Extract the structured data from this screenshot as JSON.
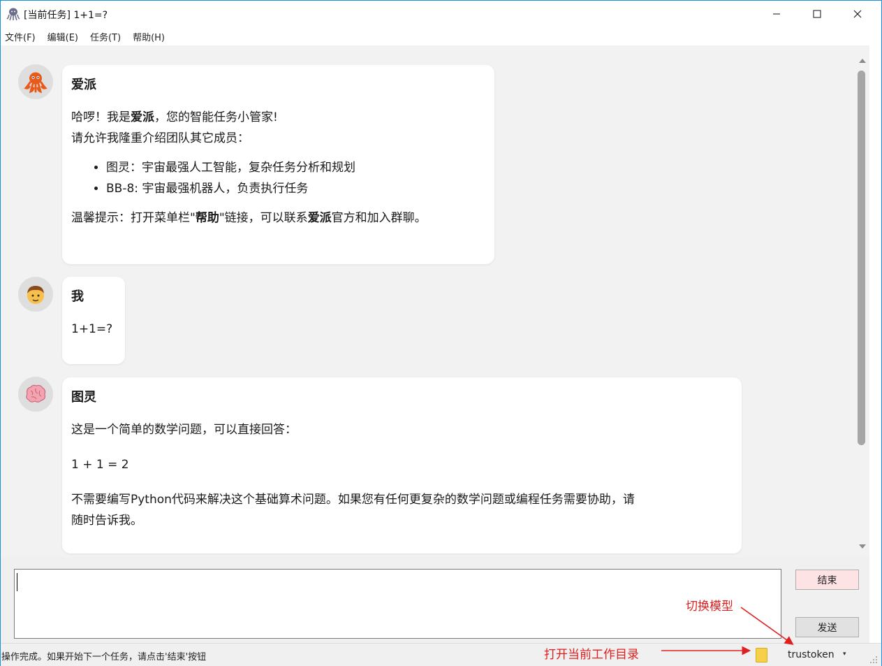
{
  "window": {
    "title": "[当前任务] 1+1=?",
    "controls": {
      "minimize": "—",
      "maximize": "☐",
      "close": "✕"
    }
  },
  "menu": [
    "文件(F)",
    "编辑(E)",
    "任务(T)",
    "帮助(H)"
  ],
  "messages": [
    {
      "sender": "爱派",
      "avatar_icon": "octopus-icon",
      "intro_1_a": "哈啰！我是",
      "intro_1_b": "爱派",
      "intro_1_c": "，您的智能任务小管家!",
      "intro_2": "请允许我隆重介绍团队其它成员：",
      "members": [
        "图灵：宇宙最强人工智能，复杂任务分析和规划",
        "BB-8: 宇宙最强机器人，负责执行任务"
      ],
      "tip_a": "温馨提示：打开菜单栏\"",
      "tip_b": "帮助",
      "tip_c": "\"链接，可以联系",
      "tip_d": "爱派",
      "tip_e": "官方和加入群聊。"
    },
    {
      "sender": "我",
      "avatar_icon": "boy-icon",
      "text": "1+1=?"
    },
    {
      "sender": "图灵",
      "avatar_icon": "brain-icon",
      "line_1": "这是一个简单的数学问题，可以直接回答：",
      "line_2": "1 + 1 = 2",
      "line_3a": "不需要编写Python代码来解决这个基础算术问题。如果您有任何更复杂的数学问题或编程任务需要协助，请",
      "line_3b": "随时告诉我。"
    }
  ],
  "input": {
    "value": ""
  },
  "buttons": {
    "end": "结束",
    "send": "发送"
  },
  "annotations": {
    "switch_model": "切换模型",
    "open_dir": "打开当前工作目录"
  },
  "status": {
    "text": "操作完成。如果开始下一个任务，请点击'结束'按钮",
    "model": "trustoken",
    "model_arrow": "▾"
  },
  "colors": {
    "annotation": "#e02020",
    "end_button_bg": "#fde3e3",
    "folder": "#f7d04a"
  }
}
